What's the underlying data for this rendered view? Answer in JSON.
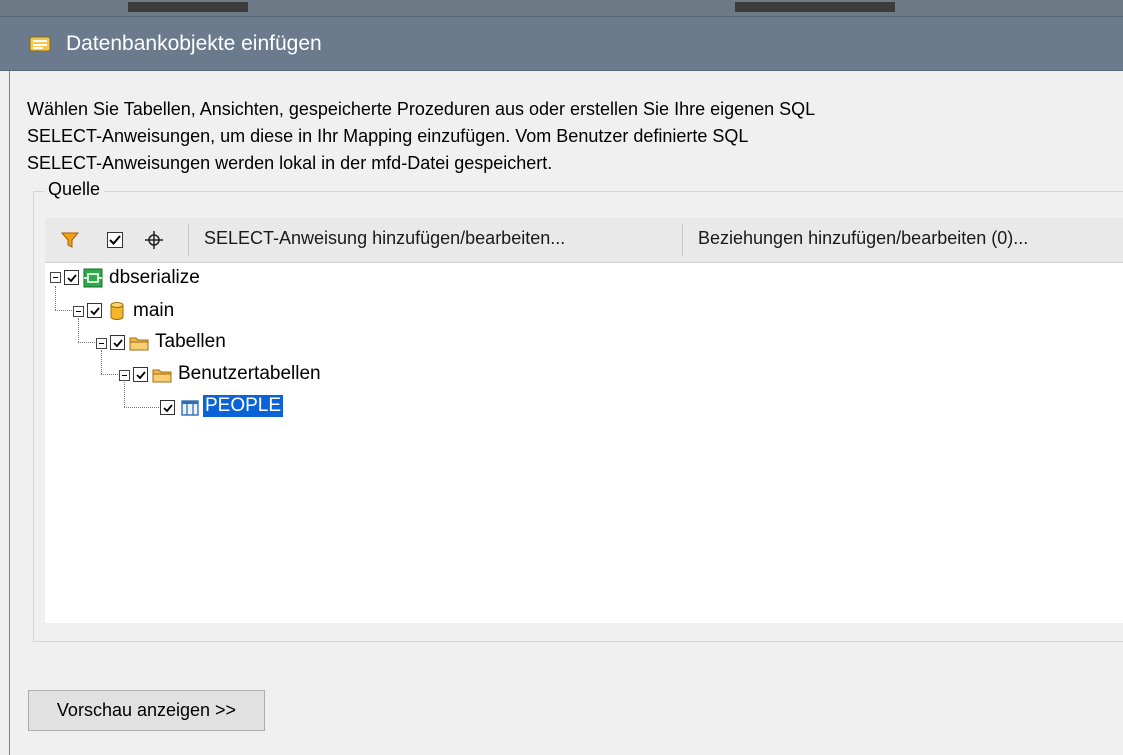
{
  "window": {
    "title": "Datenbankobjekte einfügen"
  },
  "description": {
    "lines": [
      "Wählen Sie Tabellen, Ansichten, gespeicherte Prozeduren aus oder erstellen Sie Ihre eigenen SQL",
      "SELECT-Anweisungen, um diese in Ihr Mapping einzufügen. Vom Benutzer definierte SQL",
      "SELECT-Anweisungen werden lokal in der mfd-Datei gespeichert."
    ]
  },
  "source_group": {
    "label": "Quelle",
    "toolbar": {
      "select_statement_label": "SELECT-Anweisung hinzufügen/bearbeiten...",
      "relations_label": "Beziehungen hinzufügen/bearbeiten (0)..."
    },
    "tree": [
      {
        "label": "dbserialize",
        "checked": true,
        "icon": "database-connection-icon",
        "selected": false
      },
      {
        "label": "main",
        "checked": true,
        "icon": "database-icon",
        "selected": false
      },
      {
        "label": "Tabellen",
        "checked": true,
        "icon": "folder-icon",
        "selected": false
      },
      {
        "label": "Benutzertabellen",
        "checked": true,
        "icon": "folder-icon",
        "selected": false
      },
      {
        "label": "PEOPLE",
        "checked": true,
        "icon": "table-icon",
        "selected": true
      }
    ]
  },
  "footer": {
    "preview_button_label": "Vorschau anzeigen >>"
  },
  "colors": {
    "titlebar": "#6b7b8d",
    "selection": "#0a64d8",
    "folder": "#f0b94a"
  }
}
